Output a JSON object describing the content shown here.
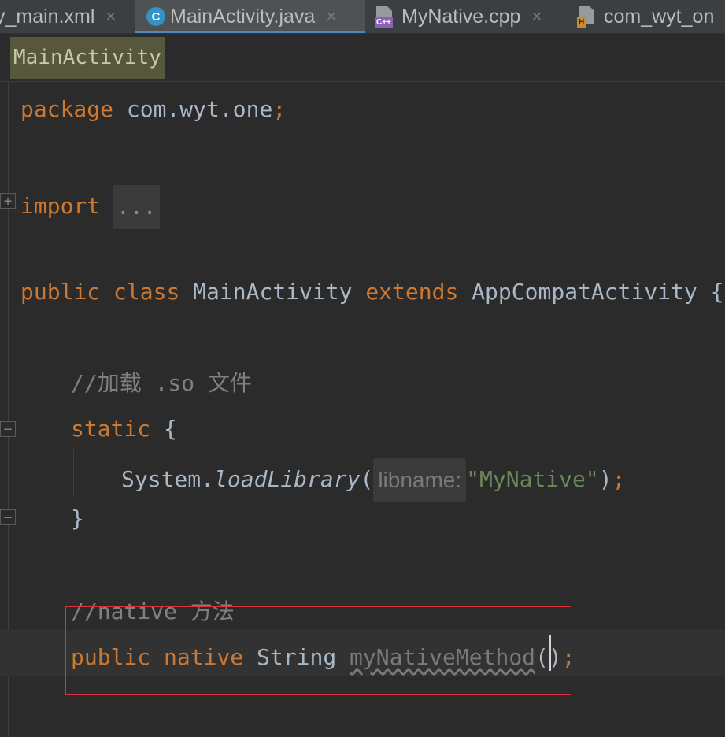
{
  "tabs": [
    {
      "label": "y_main.xml",
      "close": "×",
      "active": false
    },
    {
      "label": "MainActivity.java",
      "close": "×",
      "active": true,
      "icon": "class-icon",
      "icon_text": "C"
    },
    {
      "label": "MyNative.cpp",
      "close": "×",
      "active": false,
      "icon": "cpp-file-icon",
      "icon_text": "C++"
    },
    {
      "label": "com_wyt_on",
      "active": false,
      "icon": "header-file-icon",
      "icon_text": "H"
    }
  ],
  "breadcrumb": {
    "label": "MainActivity"
  },
  "gutter": {
    "fold_expand": "+",
    "fold_collapse": "−"
  },
  "code": {
    "l1": {
      "keyword": "package",
      "rest": " com.wyt.one",
      "semi": ";"
    },
    "l2": {
      "keyword": "import",
      "folded": "..."
    },
    "l3": {
      "kw1": "public",
      "kw2": "class",
      "name": " MainActivity ",
      "kw3": "extends",
      "rest": " AppCompatActivity {"
    },
    "l4": {
      "comment": "//加载 .so 文件"
    },
    "l5": {
      "keyword": "static",
      "rest": " {"
    },
    "l6": {
      "obj": "System.",
      "method": "loadLibrary",
      "open": "(",
      "hint": "libname:",
      "string": "\"MyNative\"",
      "close": ")",
      "semi": ";"
    },
    "l7": {
      "rest": "}"
    },
    "l8": {
      "comment": "//native 方法"
    },
    "l9": {
      "kw1": "public",
      "kw2": "native",
      "type": " String ",
      "method": "myNativeMethod",
      "parens": "()",
      "semi": ";"
    }
  },
  "colors": {
    "keyword": "#cc7832",
    "comment": "#808080",
    "string": "#6a8759",
    "text": "#a9b7c6",
    "highlight_box": "#e0303a",
    "active_tab_underline": "#4a88c7"
  }
}
